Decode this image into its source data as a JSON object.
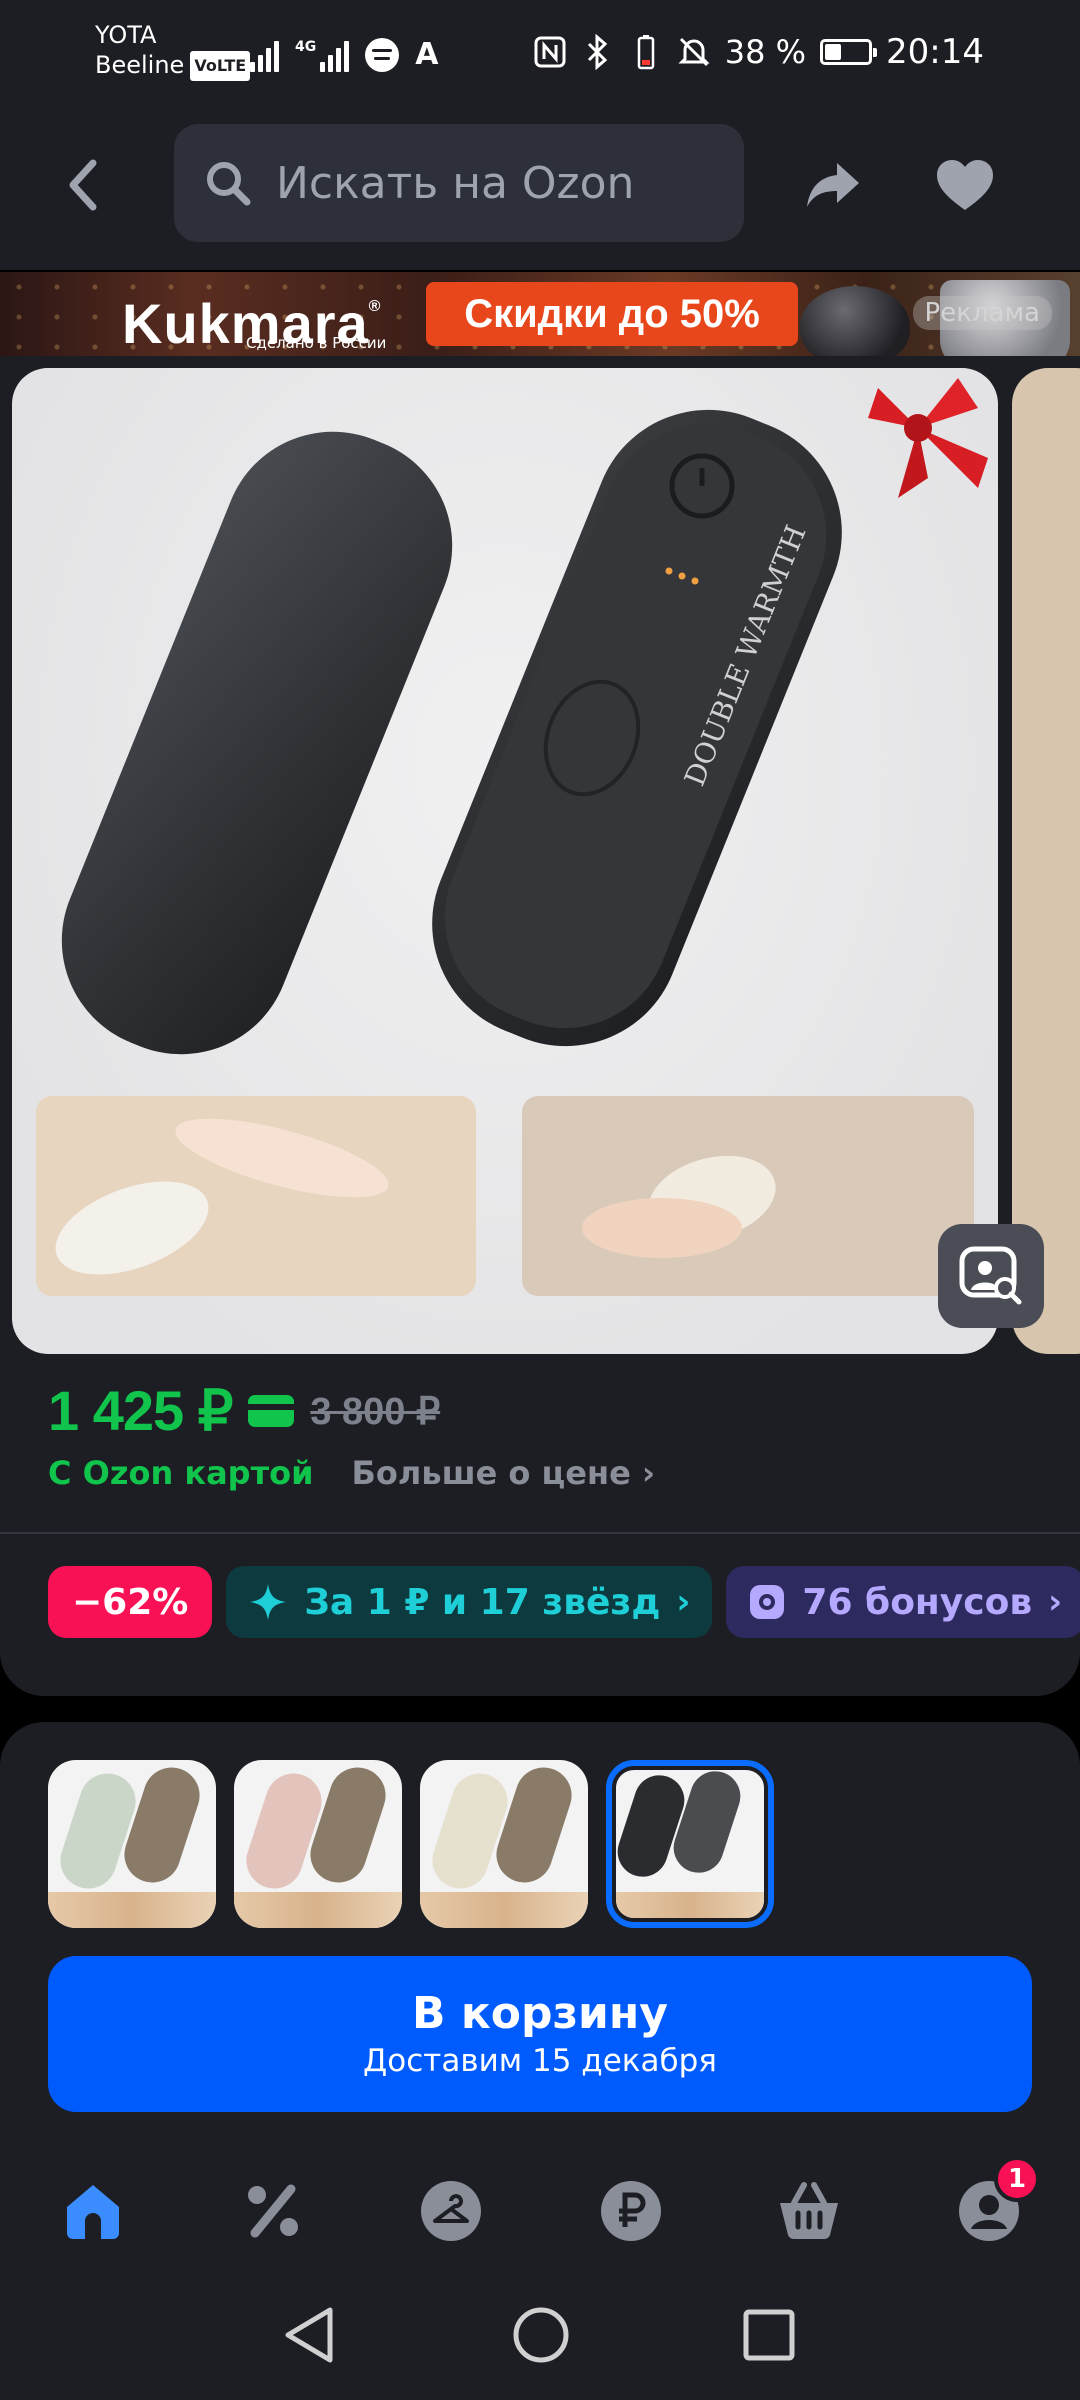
{
  "status_bar": {
    "carrier_1": "YOTA",
    "carrier_2": "Beeline",
    "volte": "VoLTE",
    "network": "4G",
    "battery": "38 %",
    "battery_level": 0.38,
    "time": "20:14"
  },
  "header": {
    "search_placeholder": "Искать на Ozon"
  },
  "banner": {
    "brand": "Kukmara",
    "brand_mark": "®",
    "brand_sub": "Сделано в России",
    "sale": "Скидки до 50%",
    "ad_label": "Реклама"
  },
  "product": {
    "image_text": "DOUBLE WARMTH",
    "price": "1 425 ₽",
    "old_price": "3 800 ₽",
    "with_card": "С Ozon картой",
    "more_price": "Больше о цене",
    "chips": {
      "discount": "−62%",
      "stars": "За 1 ₽ и 17 звёзд",
      "bonus": "76 бонусов"
    }
  },
  "variants": {
    "count": 4,
    "selected_index": 3
  },
  "cart_button": {
    "label": "В корзину",
    "delivery": "Доставим 15 декабря"
  },
  "bottom_nav": {
    "items": [
      "home-icon",
      "percent-icon",
      "hanger-icon",
      "ruble-icon",
      "basket-icon",
      "profile-icon"
    ],
    "active": "home-icon",
    "profile_badge": "1"
  },
  "colors": {
    "background": "#1c1e24",
    "accent_blue": "#005bff",
    "price_green": "#10c44c",
    "discount_pink": "#f91155"
  }
}
